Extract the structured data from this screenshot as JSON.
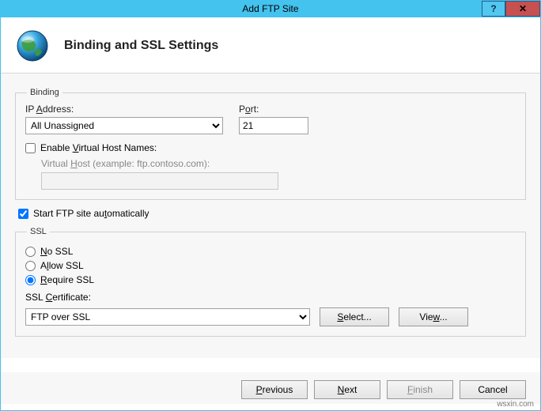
{
  "window": {
    "title": "Add FTP Site",
    "help_tooltip": "?",
    "close_tooltip": "X"
  },
  "header": {
    "title": "Binding and SSL Settings"
  },
  "binding": {
    "legend": "Binding",
    "ip_label_pre": "IP ",
    "ip_label_u": "A",
    "ip_label_post": "ddress:",
    "ip_value": "All Unassigned",
    "port_label_pre": "P",
    "port_label_u": "o",
    "port_label_post": "rt:",
    "port_value": "21",
    "enable_vhost_pre": "Enable ",
    "enable_vhost_u": "V",
    "enable_vhost_post": "irtual Host Names:",
    "enable_vhost_checked": false,
    "vhost_label_pre": "Virtual ",
    "vhost_label_u": "H",
    "vhost_label_post": "ost (example: ftp.contoso.com):",
    "vhost_value": ""
  },
  "autostart": {
    "label_pre": "Start FTP site au",
    "label_u": "t",
    "label_post": "omatically",
    "checked": true
  },
  "ssl": {
    "legend": "SSL",
    "no_ssl_u": "N",
    "no_ssl_post": "o SSL",
    "allow_pre": "A",
    "allow_u": "l",
    "allow_post": "low SSL",
    "require_u": "R",
    "require_post": "equire SSL",
    "selected": "require",
    "cert_label_pre": "SSL ",
    "cert_label_u": "C",
    "cert_label_post": "ertificate:",
    "cert_value": "FTP over SSL",
    "select_btn_u": "S",
    "select_btn_post": "elect...",
    "view_btn_pre": "Vie",
    "view_btn_u": "w",
    "view_btn_post": "..."
  },
  "footer": {
    "previous_u": "P",
    "previous_post": "revious",
    "next_u": "N",
    "next_post": "ext",
    "finish_u": "F",
    "finish_post": "inish",
    "cancel": "Cancel"
  },
  "watermark": "wsxin.com"
}
